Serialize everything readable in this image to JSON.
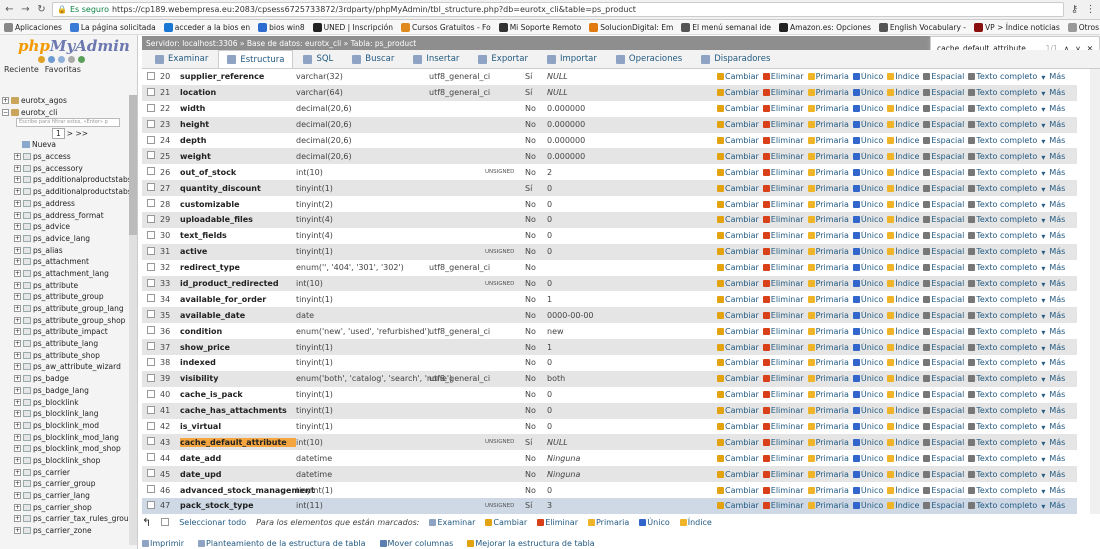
{
  "browser": {
    "secure_label": "Es seguro",
    "url": "https://cp189.webempresa.eu:2083/cpsess6725733872/3rdparty/phpMyAdmin/tbl_structure.php?db=eurotx_cli&table=ps_product",
    "bookmarks": [
      "Aplicaciones",
      "La página solicitada",
      "acceder a la bios en",
      "bios win8",
      "UNED | Inscripción",
      "Cursos Gratuitos - Fo",
      "Mi Soporte Remoto",
      "SolucionDigital: Em",
      "El menú semanal ide",
      "Amazon.es: Opciones",
      "English Vocabulary -",
      "VP > Índice noticias",
      "Otros marc"
    ]
  },
  "sidebar": {
    "logo_php": "php",
    "logo_my": "MyAdmin",
    "tab_recent": "Reciente",
    "tab_fav": "Favoritas",
    "filter_placeholder": "Escribe para filtrar estos, «Enter» p",
    "page_sel": "1",
    "databases": [
      "eurotx_agos",
      "eurotx_cli"
    ],
    "new_label": "Nueva",
    "tables": [
      "ps_access",
      "ps_accessory",
      "ps_additionalproductstabs",
      "ps_additionalproductstabs_",
      "ps_address",
      "ps_address_format",
      "ps_advice",
      "ps_advice_lang",
      "ps_alias",
      "ps_attachment",
      "ps_attachment_lang",
      "ps_attribute",
      "ps_attribute_group",
      "ps_attribute_group_lang",
      "ps_attribute_group_shop",
      "ps_attribute_impact",
      "ps_attribute_lang",
      "ps_attribute_shop",
      "ps_aw_attribute_wizard",
      "ps_badge",
      "ps_badge_lang",
      "ps_blocklink",
      "ps_blocklink_lang",
      "ps_blocklink_mod",
      "ps_blocklink_mod_lang",
      "ps_blocklink_mod_shop",
      "ps_blocklink_shop",
      "ps_carrier",
      "ps_carrier_group",
      "ps_carrier_lang",
      "ps_carrier_shop",
      "ps_carrier_tax_rules_group",
      "ps_carrier_zone"
    ]
  },
  "breadcrumb": "Servidor: localhost:3306 » Base de datos: eurotx_cli » Tabla: ps_product",
  "find": {
    "query": "cache_default_attribute",
    "count": "1/1"
  },
  "tabs": [
    "Examinar",
    "Estructura",
    "SQL",
    "Buscar",
    "Insertar",
    "Exportar",
    "Importar",
    "Operaciones",
    "Disparadores"
  ],
  "actions": [
    "Cambiar",
    "Eliminar",
    "Primaria",
    "Único",
    "Índice",
    "Espacial",
    "Texto completo",
    "Más"
  ],
  "rows": [
    {
      "n": "20",
      "name": "supplier_reference",
      "type": "varchar(32)",
      "coll": "utf8_general_ci",
      "attr": "",
      "null": "Sí",
      "def": "NULL"
    },
    {
      "n": "21",
      "name": "location",
      "type": "varchar(64)",
      "coll": "utf8_general_ci",
      "attr": "",
      "null": "Sí",
      "def": "NULL"
    },
    {
      "n": "22",
      "name": "width",
      "type": "decimal(20,6)",
      "coll": "",
      "attr": "",
      "null": "No",
      "def": "0.000000"
    },
    {
      "n": "23",
      "name": "height",
      "type": "decimal(20,6)",
      "coll": "",
      "attr": "",
      "null": "No",
      "def": "0.000000"
    },
    {
      "n": "24",
      "name": "depth",
      "type": "decimal(20,6)",
      "coll": "",
      "attr": "",
      "null": "No",
      "def": "0.000000"
    },
    {
      "n": "25",
      "name": "weight",
      "type": "decimal(20,6)",
      "coll": "",
      "attr": "",
      "null": "No",
      "def": "0.000000"
    },
    {
      "n": "26",
      "name": "out_of_stock",
      "type": "int(10)",
      "coll": "",
      "attr": "UNSIGNED",
      "null": "No",
      "def": "2"
    },
    {
      "n": "27",
      "name": "quantity_discount",
      "type": "tinyint(1)",
      "coll": "",
      "attr": "",
      "null": "Sí",
      "def": "0"
    },
    {
      "n": "28",
      "name": "customizable",
      "type": "tinyint(2)",
      "coll": "",
      "attr": "",
      "null": "No",
      "def": "0"
    },
    {
      "n": "29",
      "name": "uploadable_files",
      "type": "tinyint(4)",
      "coll": "",
      "attr": "",
      "null": "No",
      "def": "0"
    },
    {
      "n": "30",
      "name": "text_fields",
      "type": "tinyint(4)",
      "coll": "",
      "attr": "",
      "null": "No",
      "def": "0"
    },
    {
      "n": "31",
      "name": "active",
      "type": "tinyint(1)",
      "coll": "",
      "attr": "UNSIGNED",
      "null": "No",
      "def": "0"
    },
    {
      "n": "32",
      "name": "redirect_type",
      "type": "enum('', '404', '301', '302')",
      "coll": "utf8_general_ci",
      "attr": "",
      "null": "No",
      "def": ""
    },
    {
      "n": "33",
      "name": "id_product_redirected",
      "type": "int(10)",
      "coll": "",
      "attr": "UNSIGNED",
      "null": "No",
      "def": "0"
    },
    {
      "n": "34",
      "name": "available_for_order",
      "type": "tinyint(1)",
      "coll": "",
      "attr": "",
      "null": "No",
      "def": "1"
    },
    {
      "n": "35",
      "name": "available_date",
      "type": "date",
      "coll": "",
      "attr": "",
      "null": "No",
      "def": "0000-00-00"
    },
    {
      "n": "36",
      "name": "condition",
      "type": "enum('new', 'used', 'refurbished')",
      "coll": "utf8_general_ci",
      "attr": "",
      "null": "No",
      "def": "new"
    },
    {
      "n": "37",
      "name": "show_price",
      "type": "tinyint(1)",
      "coll": "",
      "attr": "",
      "null": "No",
      "def": "1"
    },
    {
      "n": "38",
      "name": "indexed",
      "type": "tinyint(1)",
      "coll": "",
      "attr": "",
      "null": "No",
      "def": "0"
    },
    {
      "n": "39",
      "name": "visibility",
      "type": "enum('both', 'catalog', 'search', 'none')",
      "coll": "utf8_general_ci",
      "attr": "",
      "null": "No",
      "def": "both"
    },
    {
      "n": "40",
      "name": "cache_is_pack",
      "type": "tinyint(1)",
      "coll": "",
      "attr": "",
      "null": "No",
      "def": "0"
    },
    {
      "n": "41",
      "name": "cache_has_attachments",
      "type": "tinyint(1)",
      "coll": "",
      "attr": "",
      "null": "No",
      "def": "0"
    },
    {
      "n": "42",
      "name": "is_virtual",
      "type": "tinyint(1)",
      "coll": "",
      "attr": "",
      "null": "No",
      "def": "0"
    },
    {
      "n": "43",
      "name": "cache_default_attribute",
      "type": "int(10)",
      "coll": "",
      "attr": "UNSIGNED",
      "null": "Sí",
      "def": "NULL"
    },
    {
      "n": "44",
      "name": "date_add",
      "type": "datetime",
      "coll": "",
      "attr": "",
      "null": "No",
      "def": "Ninguna"
    },
    {
      "n": "45",
      "name": "date_upd",
      "type": "datetime",
      "coll": "",
      "attr": "",
      "null": "No",
      "def": "Ninguna"
    },
    {
      "n": "46",
      "name": "advanced_stock_management",
      "type": "tinyint(1)",
      "coll": "",
      "attr": "",
      "null": "No",
      "def": "0"
    },
    {
      "n": "47",
      "name": "pack_stock_type",
      "type": "int(11)",
      "coll": "",
      "attr": "UNSIGNED",
      "null": "Sí",
      "def": "3"
    }
  ],
  "footer": {
    "select_all": "Seleccionar todo",
    "marked": "Para los elementos que están marcados:",
    "actions": [
      "Examinar",
      "Cambiar",
      "Eliminar",
      "Primaria",
      "Único",
      "Índice"
    ],
    "bottom": [
      "Imprimir",
      "Planteamiento de la estructura de tabla",
      "Mover columnas",
      "Mejorar la estructura de tabla"
    ]
  }
}
